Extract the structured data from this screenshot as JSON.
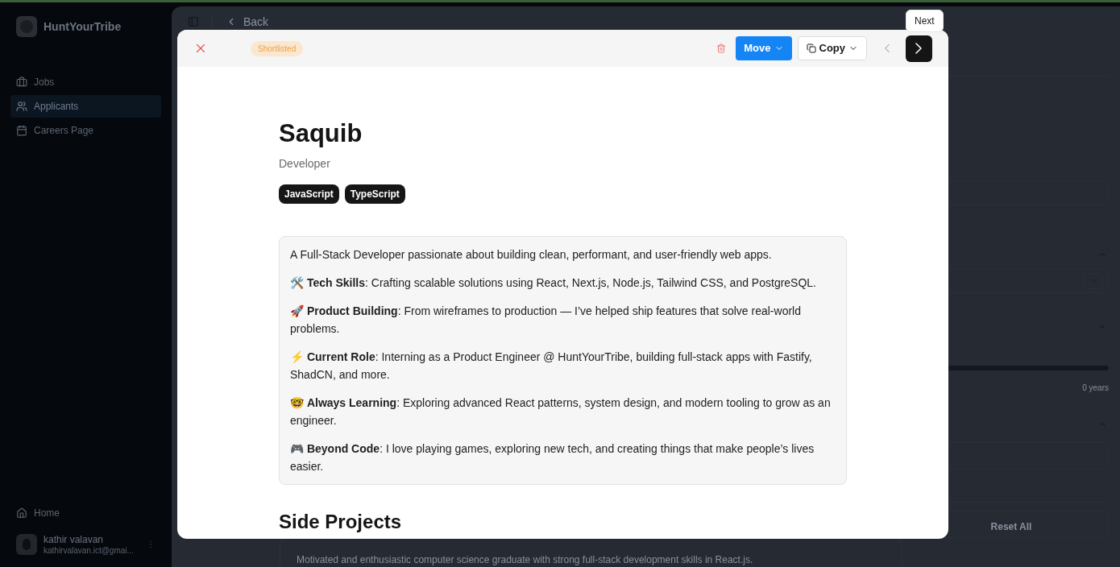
{
  "sidebar": {
    "brand": "HuntYourTribe",
    "items": [
      {
        "label": "Jobs",
        "selected": false
      },
      {
        "label": "Applicants",
        "selected": true
      },
      {
        "label": "Careers Page",
        "selected": false
      }
    ],
    "footer_item": {
      "label": "Home"
    },
    "user": {
      "name": "kathir valavan",
      "email": "kathirvalavan.ict@gmai..."
    }
  },
  "topbar": {
    "back": "Back"
  },
  "background_page": {
    "experience_slider": {
      "level": 1
    },
    "experience_reading": "0 years",
    "reset": "Reset All",
    "summary": "Motivated and enthusiastic computer science graduate with strong full-stack development skills in React.js."
  },
  "modal": {
    "status": "Shortlisted",
    "move": "Move",
    "copy": "Copy",
    "tooltip": "Next",
    "name": "Saquib",
    "role": "Developer",
    "skills": [
      "JavaScript",
      "TypeScript"
    ],
    "bio": [
      "A Full-Stack Developer passionate about building clean, performant, and user-friendly web apps.",
      "🛠️ **Tech Skills**: Crafting scalable solutions using React, Next.js, Node.js, Tailwind CSS, and PostgreSQL.",
      "🚀 **Product Building**: From wireframes to production — I’ve helped ship features that solve real-world problems.",
      "⚡ **Current Role**: Interning as a Product Engineer @ HuntYourTribe, building full-stack apps with Fastify, ShadCN, and more.",
      "🤓 **Always Learning**: Exploring advanced React patterns, system design, and modern tooling to grow as an engineer.",
      "🎮 **Beyond Code**: I love playing games, exploring new tech, and creating things that make people’s lives easier."
    ],
    "section_title": "Side Projects"
  }
}
